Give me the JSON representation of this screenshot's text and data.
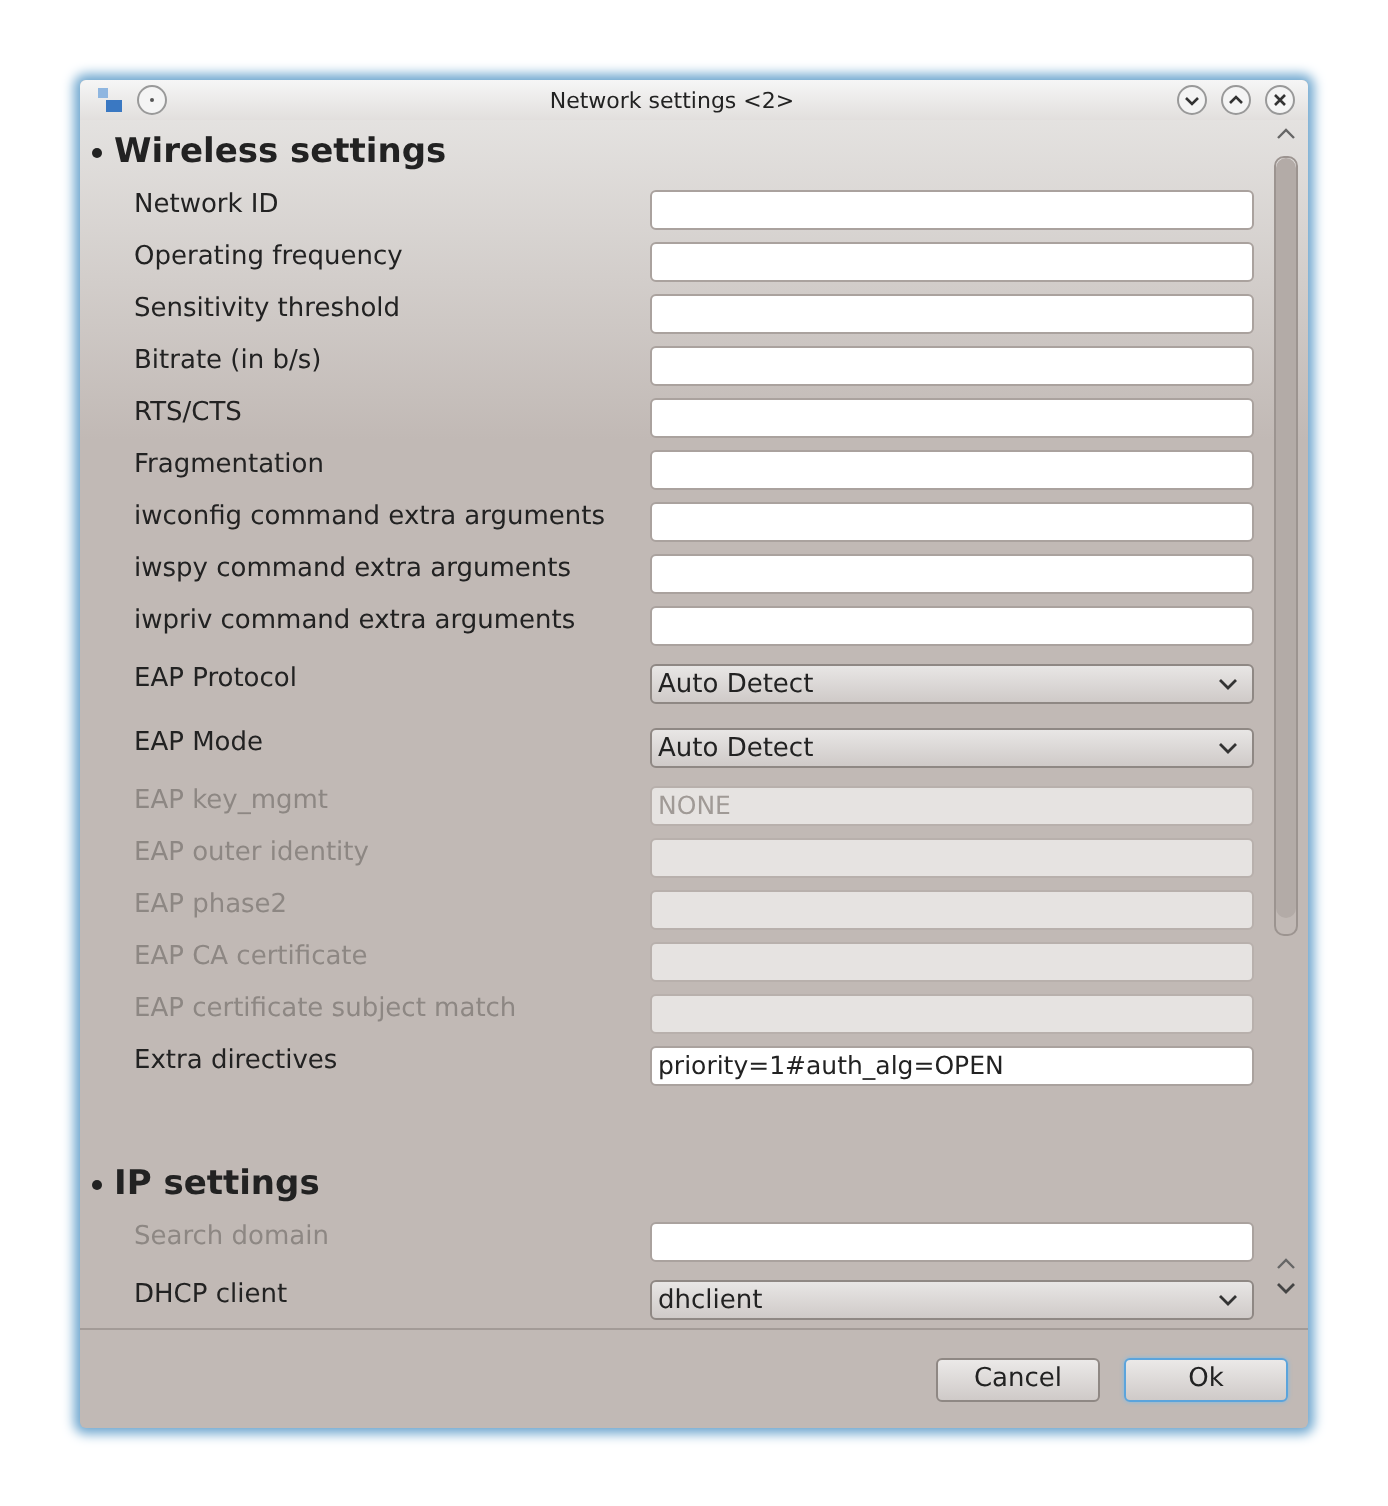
{
  "window": {
    "title": "Network settings <2>"
  },
  "sections": [
    {
      "heading": "Wireless settings",
      "rows": [
        {
          "label": "Network ID",
          "kind": "text",
          "value": "",
          "disabled": false,
          "field_disabled": false
        },
        {
          "label": "Operating frequency",
          "kind": "text",
          "disabled": false,
          "field_disabled": false
        },
        {
          "label": "Sensitivity threshold",
          "kind": "text",
          "disabled": false,
          "field_disabled": false
        },
        {
          "label": "Bitrate (in b/s)",
          "kind": "text",
          "disabled": false,
          "field_disabled": false
        },
        {
          "label": "RTS/CTS",
          "kind": "text",
          "disabled": false,
          "field_disabled": false
        },
        {
          "label": "Fragmentation",
          "kind": "text",
          "disabled": false,
          "field_disabled": false
        },
        {
          "label": "iwconfig command extra arguments",
          "kind": "text",
          "disabled": false,
          "field_disabled": false
        },
        {
          "label": "iwspy command extra arguments",
          "kind": "text",
          "disabled": false,
          "field_disabled": false
        },
        {
          "label": "iwpriv command extra arguments",
          "kind": "text",
          "disabled": false,
          "field_disabled": false
        },
        {
          "label": "EAP Protocol",
          "kind": "combo",
          "value": "Auto Detect",
          "disabled": false
        },
        {
          "label": "EAP Mode",
          "kind": "combo",
          "value": "Auto Detect",
          "disabled": false
        },
        {
          "label": "EAP key_mgmt",
          "kind": "text",
          "value": "NONE",
          "disabled": true,
          "field_disabled": true
        },
        {
          "label": "EAP outer identity",
          "kind": "text",
          "disabled": true,
          "field_disabled": true
        },
        {
          "label": "EAP phase2",
          "kind": "text",
          "disabled": true,
          "field_disabled": true
        },
        {
          "label": "EAP CA certificate",
          "kind": "text",
          "disabled": true,
          "field_disabled": true
        },
        {
          "label": "EAP certificate subject match",
          "kind": "text",
          "disabled": true,
          "field_disabled": true
        },
        {
          "label": "Extra directives",
          "kind": "text",
          "value": "priority=1#auth_alg=OPEN",
          "disabled": false,
          "field_disabled": false
        }
      ]
    },
    {
      "heading": "IP settings",
      "rows": [
        {
          "label": "Search domain",
          "kind": "text",
          "disabled": true,
          "field_disabled": false
        },
        {
          "label": "DHCP client",
          "kind": "combo",
          "value": "dhclient",
          "disabled": false
        }
      ]
    }
  ],
  "buttons": [
    {
      "label": "Cancel",
      "selected": false
    },
    {
      "label": "Ok",
      "selected": true
    }
  ]
}
